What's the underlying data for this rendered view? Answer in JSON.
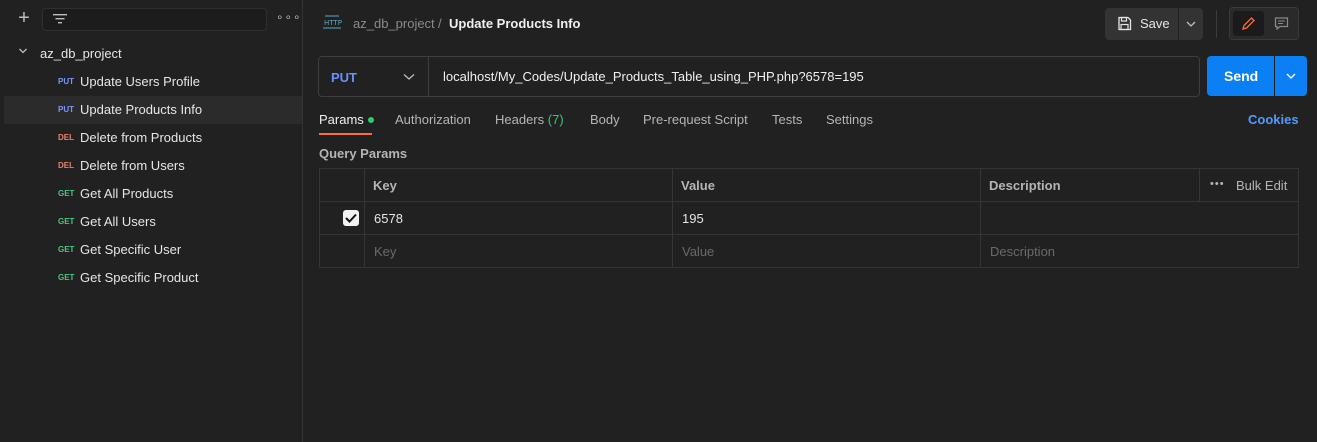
{
  "sidebar": {
    "collection_name": "az_db_project",
    "requests": [
      {
        "method": "PUT",
        "method_color": "#7d95ff",
        "label": "Update Users Profile"
      },
      {
        "method": "PUT",
        "method_color": "#7d95ff",
        "label": "Update Products Info"
      },
      {
        "method": "DEL",
        "method_color": "#e8826c",
        "label": "Delete from Products"
      },
      {
        "method": "DEL",
        "method_color": "#e8826c",
        "label": "Delete from Users"
      },
      {
        "method": "GET",
        "method_color": "#45c880",
        "label": "Get All Products"
      },
      {
        "method": "GET",
        "method_color": "#45c880",
        "label": "Get All Users"
      },
      {
        "method": "GET",
        "method_color": "#45c880",
        "label": "Get Specific User"
      },
      {
        "method": "GET",
        "method_color": "#45c880",
        "label": "Get Specific Product"
      }
    ],
    "active_index": 1
  },
  "header": {
    "breadcrumb_parent": "az_db_project",
    "breadcrumb_separator": "/",
    "breadcrumb_current": "Update Products Info",
    "save_label": "Save"
  },
  "request": {
    "method": "PUT",
    "url": "localhost/My_Codes/Update_Products_Table_using_PHP.php?6578=195",
    "send_label": "Send"
  },
  "tabs": {
    "params": "Params",
    "authorization": "Authorization",
    "headers": "Headers",
    "headers_count": "(7)",
    "body": "Body",
    "pre_request": "Pre-request Script",
    "tests": "Tests",
    "settings": "Settings",
    "cookies": "Cookies"
  },
  "query_params": {
    "title": "Query Params",
    "columns": {
      "key": "Key",
      "value": "Value",
      "description": "Description",
      "bulk_edit": "Bulk Edit"
    },
    "rows": [
      {
        "checked": true,
        "key": "6578",
        "value": "195",
        "description": ""
      }
    ],
    "placeholders": {
      "key": "Key",
      "value": "Value",
      "description": "Description"
    }
  },
  "colors": {
    "accent_orange": "#ff6c37",
    "send_blue": "#0b7ff4",
    "params_dot": "#2dcc71"
  }
}
